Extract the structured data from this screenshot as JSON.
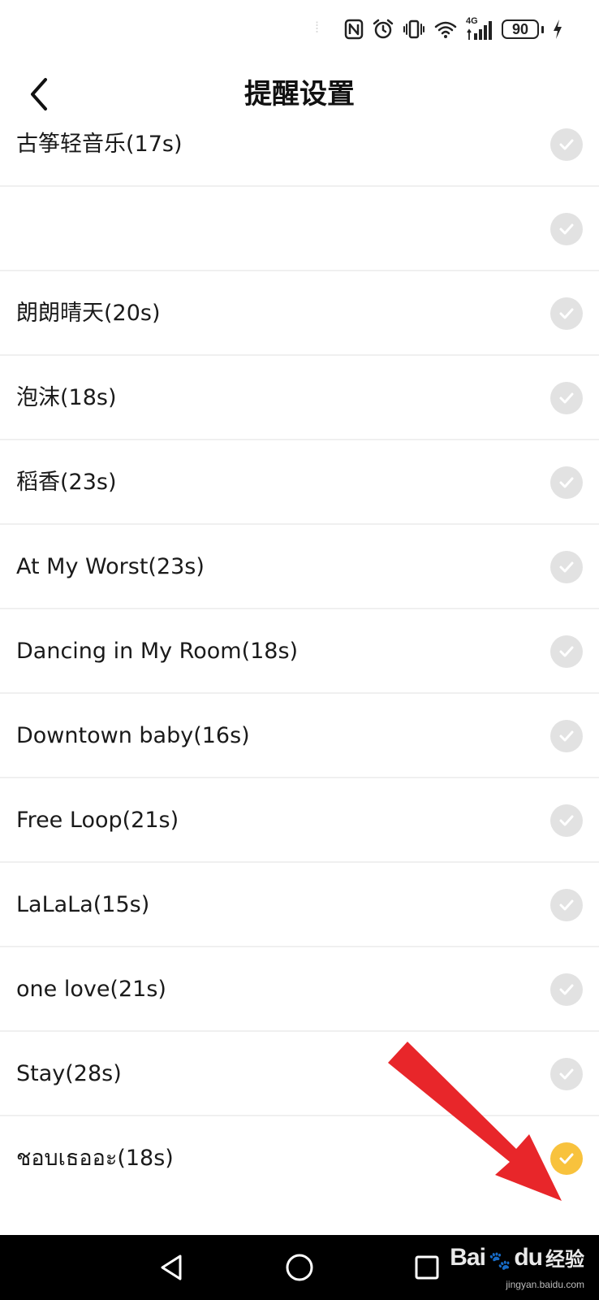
{
  "status_bar": {
    "battery_level": "90",
    "network_label": "4G",
    "icons": [
      "nfc-icon",
      "alarm-icon",
      "vibrate-icon",
      "wifi-icon",
      "signal-icon",
      "battery-icon",
      "charging-icon"
    ]
  },
  "header": {
    "title": "提醒设置",
    "back_icon": "chevron-left-icon"
  },
  "sounds": [
    {
      "label": "古筝轻音乐(17s)",
      "selected": false
    },
    {
      "label": "",
      "selected": false
    },
    {
      "label": "朗朗晴天(20s)",
      "selected": false
    },
    {
      "label": "泡沫(18s)",
      "selected": false
    },
    {
      "label": "稻香(23s)",
      "selected": false
    },
    {
      "label": "At My Worst(23s)",
      "selected": false
    },
    {
      "label": "Dancing in My Room(18s)",
      "selected": false
    },
    {
      "label": "Downtown baby(16s)",
      "selected": false
    },
    {
      "label": "Free Loop(21s)",
      "selected": false
    },
    {
      "label": "LaLaLa(15s)",
      "selected": false
    },
    {
      "label": "one love(21s)",
      "selected": false
    },
    {
      "label": "Stay(28s)",
      "selected": false
    },
    {
      "label": "ชอบเธออะ(18s)",
      "selected": true
    }
  ],
  "colors": {
    "selected_check": "#f8c23d",
    "unselected_check": "#e2e2e2",
    "annotation_arrow": "#e8262a"
  },
  "nav_bar": {
    "icons": [
      "back-triangle-icon",
      "home-circle-icon",
      "recents-square-icon"
    ]
  },
  "watermark": {
    "logo_text": "Bai",
    "logo_text_2": "du",
    "product_text": "经验",
    "url": "jingyan.baidu.com"
  }
}
